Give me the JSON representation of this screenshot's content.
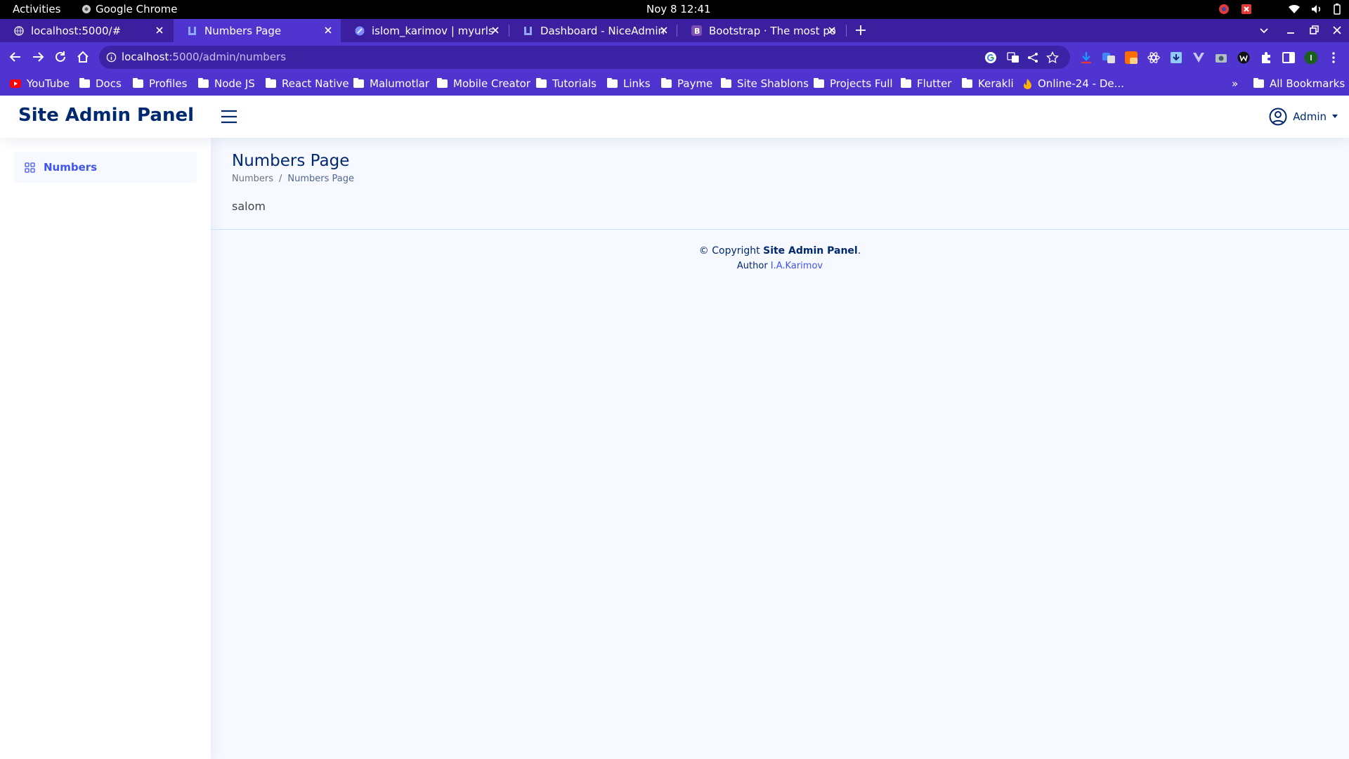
{
  "system": {
    "activities": "Activities",
    "app_name": "Google Chrome",
    "clock": "Noy 8  12:41"
  },
  "tabs": [
    {
      "title": "localhost:5000/#"
    },
    {
      "title": "Numbers Page"
    },
    {
      "title": "islom_karimov | myurls"
    },
    {
      "title": "Dashboard - NiceAdmin B"
    },
    {
      "title": "Bootstrap · The most pop"
    }
  ],
  "address_bar": {
    "host": "localhost",
    "path": ":5000/admin/numbers"
  },
  "bookmarks": [
    "YouTube",
    "Docs",
    "Profiles",
    "Node JS",
    "React Native",
    "Malumotlar",
    "Mobile Creator",
    "Tutorials",
    "Links",
    "Payme",
    "Site Shablons",
    "Projects Full",
    "Flutter",
    "Kerakli",
    "Online-24 - De...",
    "»",
    "All Bookmarks"
  ],
  "header": {
    "logo": "Site Admin Panel",
    "user": "Admin"
  },
  "sidebar": {
    "items": [
      {
        "label": "Numbers"
      }
    ]
  },
  "main": {
    "title": "Numbers Page",
    "breadcrumb": [
      "Numbers",
      "/",
      "Numbers Page"
    ],
    "content": "salom"
  },
  "footer": {
    "copyright_prefix": "© Copyright ",
    "copyright_brand": "Site Admin Panel",
    "copyright_suffix": ".",
    "author_label": "Author ",
    "author_name": "I.A.Karimov"
  },
  "colors": {
    "chrome_accent": "#4f34cf",
    "brand": "#012970",
    "link": "#4154f1",
    "page_bg": "#f6f9ff"
  }
}
